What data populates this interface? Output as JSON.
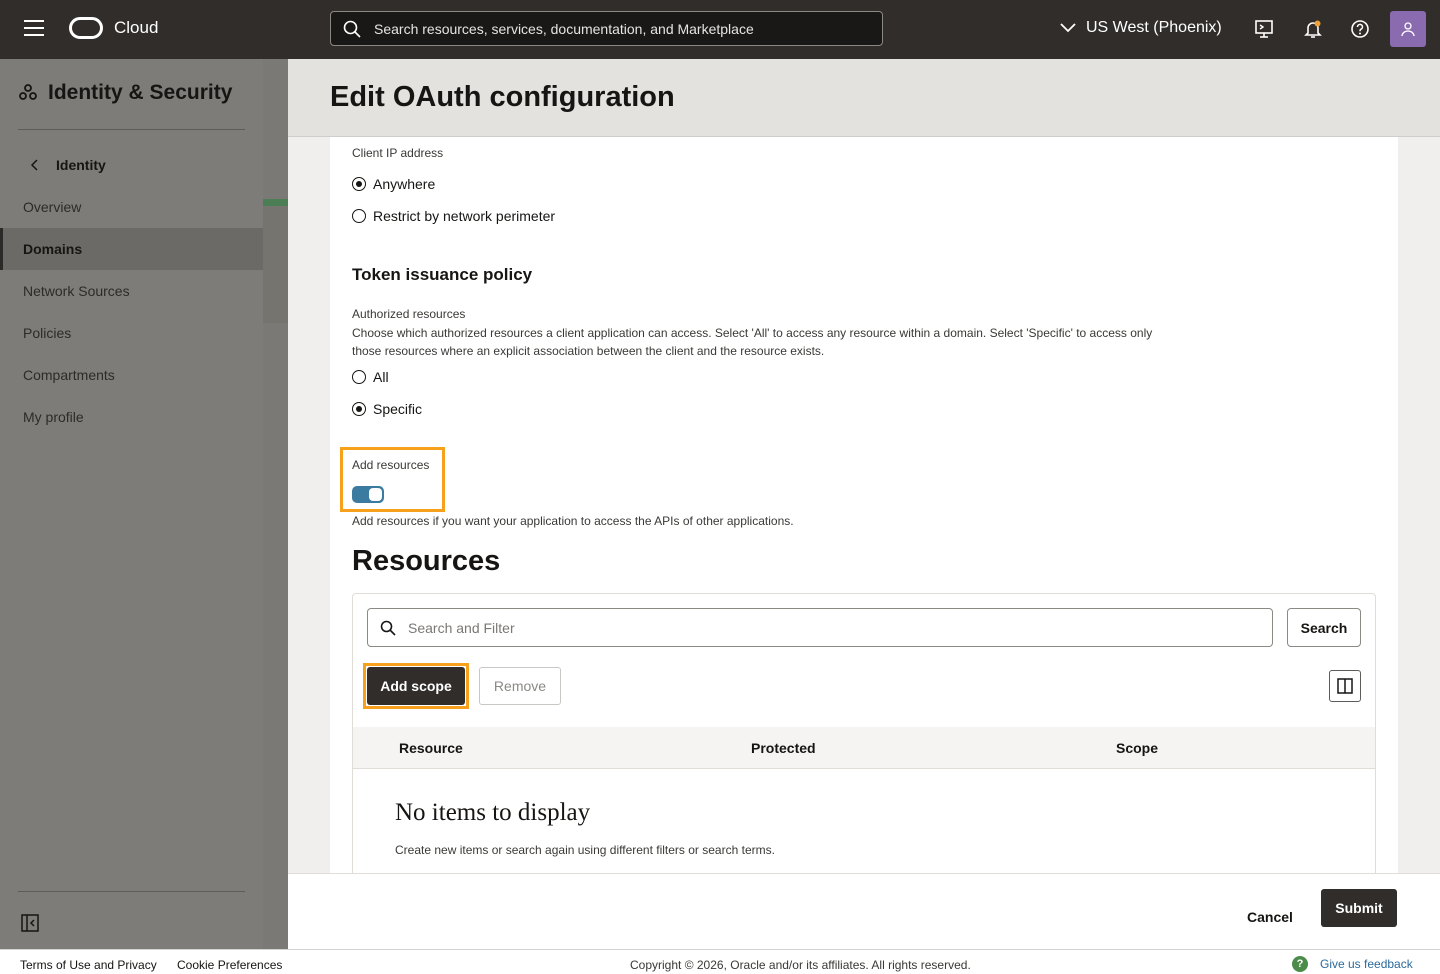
{
  "topbar": {
    "brand": "Cloud",
    "search_placeholder": "Search resources, services, documentation, and Marketplace",
    "region": "US West (Phoenix)"
  },
  "sidebar": {
    "title": "Identity & Security",
    "back_label": "Identity",
    "items": [
      {
        "label": "Overview",
        "active": false
      },
      {
        "label": "Domains",
        "active": true
      },
      {
        "label": "Network Sources",
        "active": false
      },
      {
        "label": "Policies",
        "active": false
      },
      {
        "label": "Compartments",
        "active": false
      },
      {
        "label": "My profile",
        "active": false
      }
    ]
  },
  "panel": {
    "title": "Edit OAuth configuration",
    "client_ip": {
      "label": "Client IP address",
      "options": [
        {
          "label": "Anywhere",
          "checked": true
        },
        {
          "label": "Restrict by network perimeter",
          "checked": false
        }
      ]
    },
    "token_policy": {
      "title": "Token issuance policy",
      "authorized_label": "Authorized resources",
      "authorized_desc": "Choose which authorized resources a client application can access. Select 'All' to access any resource within a domain. Select 'Specific' to access only those resources where an explicit association between the client and the resource exists.",
      "options": [
        {
          "label": "All",
          "checked": false
        },
        {
          "label": "Specific",
          "checked": true
        }
      ]
    },
    "add_resources": {
      "label": "Add resources",
      "enabled": true,
      "help": "Add resources if you want your application to access the APIs of other applications."
    },
    "resources": {
      "title": "Resources",
      "filter_placeholder": "Search and Filter",
      "search_label": "Search",
      "add_scope_label": "Add scope",
      "remove_label": "Remove",
      "columns": [
        "Resource",
        "Protected",
        "Scope"
      ],
      "empty_title": "No items to display",
      "empty_desc": "Create new items or search again using different filters or search terms."
    },
    "footer": {
      "cancel_label": "Cancel",
      "submit_label": "Submit"
    }
  },
  "bottombar": {
    "terms": "Terms of Use and Privacy",
    "cookies": "Cookie Preferences",
    "copyright": "Copyright © 2026, Oracle and/or its affiliates. All rights reserved.",
    "feedback": "Give us feedback"
  },
  "colors": {
    "topbar": "#312d2a",
    "highlight": "#f7a01b",
    "toggle_on": "#3c7ba0",
    "primary_button": "#312d2a",
    "link": "#2c6a9b"
  }
}
